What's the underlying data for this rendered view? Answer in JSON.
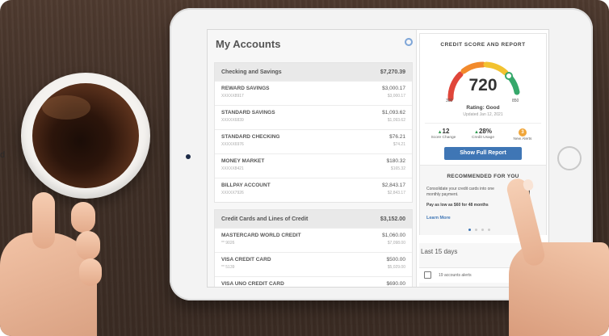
{
  "stray_text": "d",
  "accounts": {
    "title": "My Accounts",
    "sections": [
      {
        "name": "Checking and Savings",
        "total": "$7,270.39",
        "rows": [
          {
            "name": "REWARD SAVINGS",
            "num": "XXXXX8917",
            "amount": "$3,000.17",
            "available": "$3,000.17"
          },
          {
            "name": "STANDARD SAVINGS",
            "num": "XXXXX6839",
            "amount": "$1,093.62",
            "available": "$1,093.62"
          },
          {
            "name": "STANDARD CHECKING",
            "num": "XXXXX6976",
            "amount": "$76.21",
            "available": "$74.21"
          },
          {
            "name": "MONEY MARKET",
            "num": "XXXXX8421",
            "amount": "$180.32",
            "available": "$165.32"
          },
          {
            "name": "BILLPAY ACCOUNT",
            "num": "XXXXX7926",
            "amount": "$2,843.17",
            "available": "$2,843.17"
          }
        ]
      },
      {
        "name": "Credit Cards and Lines of Credit",
        "total": "$3,152.00",
        "rows": [
          {
            "name": "MASTERCARD WORLD CREDIT",
            "num": "** 9026",
            "amount": "$1,060.00",
            "available": "$7,098.00"
          },
          {
            "name": "VISA CREDIT CARD",
            "num": "** 5139",
            "amount": "$500.00",
            "available": "$5,029.00"
          },
          {
            "name": "VISA UNO CREDIT CARD",
            "num": "",
            "amount": "$690.00",
            "available": ""
          }
        ]
      }
    ]
  },
  "credit": {
    "title": "CREDIT SCORE AND REPORT",
    "score": "720",
    "min": "300",
    "max": "850",
    "rating": "Rating: Good",
    "updated": "Updated Jan 12, 2021",
    "stats": [
      {
        "value": "12",
        "label": "Score Change",
        "arrow": "▲"
      },
      {
        "value": "28%",
        "label": "Credit Usage",
        "arrow": "▲"
      },
      {
        "value": "3",
        "label": "New Alerts",
        "arrow": ""
      }
    ],
    "report_button": "Show Full Report",
    "recommended": {
      "title": "RECOMMENDED FOR YOU",
      "text": "Consolidate your credit cards into one monthly payment.",
      "pay": "Pay as low as $60 for 48 months",
      "learn_more": "Learn More"
    }
  },
  "last15": {
    "title": "Last 15 days",
    "alerts": "19 accounts alerts"
  },
  "colors": {
    "accent": "#3f76b5",
    "positive": "#2e9b4e",
    "alert": "#f0a63a",
    "gauge_red": "#e0463a",
    "gauge_yellow": "#f2c230",
    "gauge_green": "#36a86b"
  }
}
